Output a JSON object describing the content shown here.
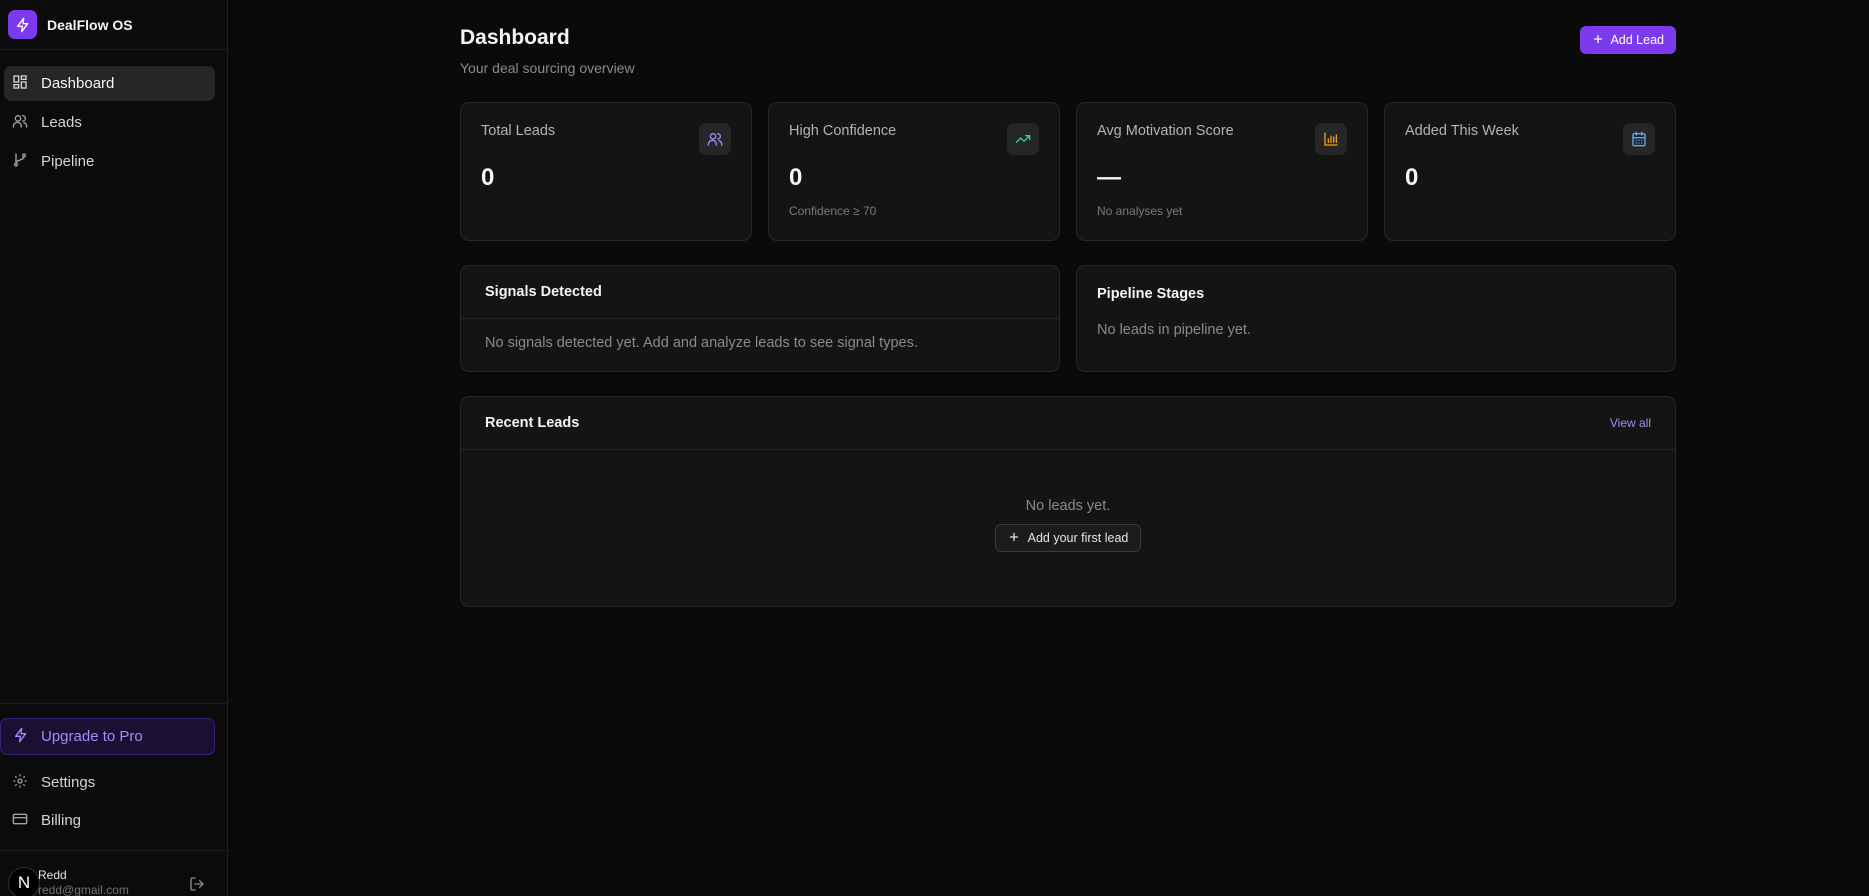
{
  "app": {
    "name": "DealFlow OS"
  },
  "sidebar": {
    "nav": [
      {
        "label": "Dashboard",
        "icon": "layout-grid-icon",
        "active": true
      },
      {
        "label": "Leads",
        "icon": "users-icon"
      },
      {
        "label": "Pipeline",
        "icon": "git-branch-icon"
      }
    ],
    "upgrade_label": "Upgrade to Pro",
    "bottom_nav": [
      {
        "label": "Settings",
        "icon": "gear-icon"
      },
      {
        "label": "Billing",
        "icon": "credit-card-icon"
      }
    ],
    "user": {
      "avatar_letter": "N",
      "name": "Redd",
      "email": "redd@gmail.com"
    }
  },
  "header": {
    "title": "Dashboard",
    "subtitle": "Your deal sourcing overview",
    "add_lead_label": "Add Lead"
  },
  "stats": [
    {
      "label": "Total Leads",
      "value": "0",
      "note": "",
      "icon": "users-icon",
      "color": "#a78bfa"
    },
    {
      "label": "High Confidence",
      "value": "0",
      "note": "Confidence ≥ 70",
      "icon": "trending-up-icon",
      "color": "#34d399"
    },
    {
      "label": "Avg Motivation Score",
      "value": "—",
      "note": "No analyses yet",
      "icon": "bar-chart-icon",
      "color": "#f59e0b"
    },
    {
      "label": "Added This Week",
      "value": "0",
      "note": "",
      "icon": "calendar-icon",
      "color": "#60a5fa"
    }
  ],
  "signals": {
    "title": "Signals Detected",
    "empty": "No signals detected yet. Add and analyze leads to see signal types."
  },
  "pipeline": {
    "title": "Pipeline Stages",
    "empty": "No leads in pipeline yet."
  },
  "recent": {
    "title": "Recent Leads",
    "view_all": "View all",
    "empty": "No leads yet.",
    "add_first_label": "Add your first lead"
  },
  "colors": {
    "accent": "#7c3aed",
    "accent_text": "#a78bfa",
    "bg": "#0a0a0a",
    "card": "#141414"
  }
}
